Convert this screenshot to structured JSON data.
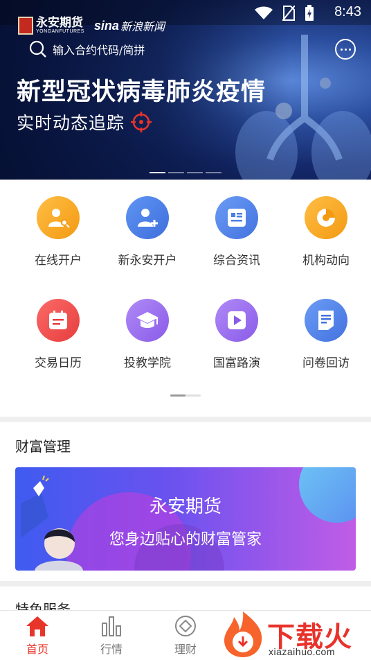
{
  "status_bar": {
    "time": "8:43"
  },
  "banner": {
    "logo_yongan_cn": "永安期货",
    "logo_yongan_en": "YONGANFUTURES",
    "logo_sina_brand": "sina",
    "logo_sina_cn": "新浪新闻",
    "search_placeholder": "输入合约代码/简拼",
    "headline": "新型冠状病毒肺炎疫情",
    "subline": "实时动态追踪",
    "slide_count": 4,
    "active_slide": 1
  },
  "grid": {
    "items": [
      {
        "label": "在线开户",
        "icon": "person-key-icon",
        "color": "#f5a623"
      },
      {
        "label": "新永安开户",
        "icon": "person-add-icon",
        "color": "#4a7de8"
      },
      {
        "label": "综合资讯",
        "icon": "news-list-icon",
        "color": "#4a7de8"
      },
      {
        "label": "机构动向",
        "icon": "pie-chart-icon",
        "color": "#f5a623"
      },
      {
        "label": "交易日历",
        "icon": "calendar-icon",
        "color": "#ef4a4a"
      },
      {
        "label": "投教学院",
        "icon": "graduation-cap-icon",
        "color": "#9b6cf0"
      },
      {
        "label": "国富路演",
        "icon": "play-icon",
        "color": "#9b6cf0"
      },
      {
        "label": "问卷回访",
        "icon": "survey-doc-icon",
        "color": "#4a7de8"
      }
    ]
  },
  "wealth": {
    "title": "财富管理",
    "banner_title": "永安期货",
    "banner_subtitle": "您身边贴心的财富管家"
  },
  "special": {
    "title": "特色服务"
  },
  "tabbar": {
    "tabs": [
      {
        "label": "首页",
        "icon": "home-icon",
        "active": true
      },
      {
        "label": "行情",
        "icon": "bar-chart-icon",
        "active": false
      },
      {
        "label": "理财",
        "icon": "diamond-coin-icon",
        "active": false
      }
    ]
  },
  "watermark": {
    "text": "下载火",
    "url": "xiazaihuo.com"
  },
  "colors": {
    "accent": "#e8352a",
    "orange": "#f5a623",
    "blue": "#4a7de8",
    "purple": "#9b6cf0",
    "red": "#ef4a4a"
  }
}
